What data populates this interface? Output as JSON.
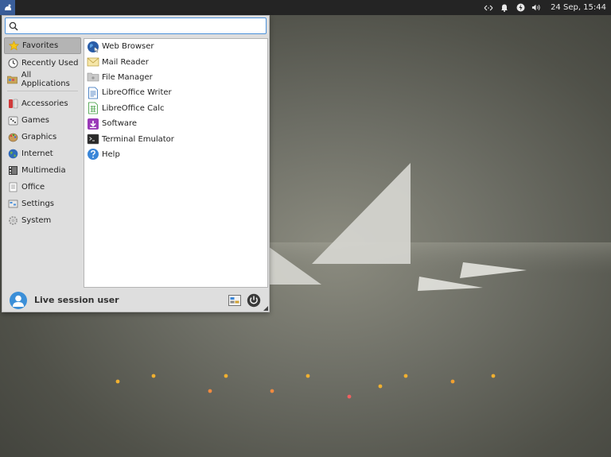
{
  "panel": {
    "clock": "24 Sep, 15:44",
    "tray_icons": [
      "network-icon",
      "notification-bell-icon",
      "power-manager-icon",
      "volume-icon"
    ]
  },
  "search": {
    "value": "",
    "placeholder": ""
  },
  "categories": [
    {
      "label": "Favorites",
      "icon": "star-icon",
      "selected": true
    },
    {
      "label": "Recently Used",
      "icon": "clock-icon"
    },
    {
      "label": "All Applications",
      "icon": "folder-icon"
    },
    {
      "label": "Accessories",
      "icon": "accessories-icon"
    },
    {
      "label": "Games",
      "icon": "games-icon"
    },
    {
      "label": "Graphics",
      "icon": "graphics-icon"
    },
    {
      "label": "Internet",
      "icon": "globe-icon"
    },
    {
      "label": "Multimedia",
      "icon": "multimedia-icon"
    },
    {
      "label": "Office",
      "icon": "office-icon"
    },
    {
      "label": "Settings",
      "icon": "settings-icon"
    },
    {
      "label": "System",
      "icon": "system-gear-icon"
    }
  ],
  "apps": [
    {
      "label": "Web Browser",
      "icon": "web-browser-icon"
    },
    {
      "label": "Mail Reader",
      "icon": "mail-icon"
    },
    {
      "label": "File Manager",
      "icon": "file-manager-icon"
    },
    {
      "label": "LibreOffice Writer",
      "icon": "writer-icon"
    },
    {
      "label": "LibreOffice Calc",
      "icon": "calc-icon"
    },
    {
      "label": "Software",
      "icon": "software-icon"
    },
    {
      "label": "Terminal Emulator",
      "icon": "terminal-icon"
    },
    {
      "label": "Help",
      "icon": "help-icon"
    }
  ],
  "footer": {
    "username": "Live session user"
  },
  "colors": {
    "accent": "#4a90d9",
    "panel": "#242424",
    "avatar": "#3b8fd8"
  }
}
